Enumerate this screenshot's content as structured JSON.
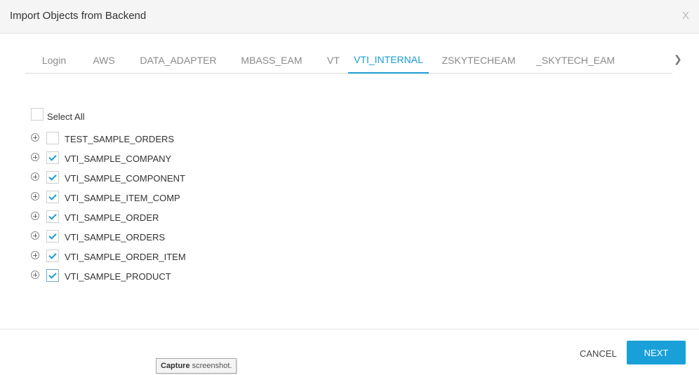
{
  "dialog": {
    "title": "Import Objects from Backend",
    "close_label": "X"
  },
  "tabs": [
    {
      "label": "Login",
      "active": false
    },
    {
      "label": "AWS",
      "active": false
    },
    {
      "label": "DATA_ADAPTER",
      "active": false
    },
    {
      "label": "MBASS_EAM",
      "active": false
    },
    {
      "label": "VT",
      "active": false
    },
    {
      "label": "VTI_INTERNAL",
      "active": true
    },
    {
      "label": "ZSKYTECHEAM",
      "active": false
    },
    {
      "label": "_SKYTECH_EAM",
      "active": false
    }
  ],
  "tab_next_glyph": "❯",
  "select_all": {
    "label": "Select All",
    "checked": false
  },
  "objects": [
    {
      "name": "TEST_SAMPLE_ORDERS",
      "checked": false
    },
    {
      "name": "VTI_SAMPLE_COMPANY",
      "checked": true
    },
    {
      "name": "VTI_SAMPLE_COMPONENT",
      "checked": true
    },
    {
      "name": "VTI_SAMPLE_ITEM_COMP",
      "checked": true
    },
    {
      "name": "VTI_SAMPLE_ORDER",
      "checked": true
    },
    {
      "name": "VTI_SAMPLE_ORDERS",
      "checked": true
    },
    {
      "name": "VTI_SAMPLE_ORDER_ITEM",
      "checked": true
    },
    {
      "name": "VTI_SAMPLE_PRODUCT",
      "checked": true
    }
  ],
  "footer": {
    "cancel_label": "CANCEL",
    "next_label": "NEXT"
  },
  "tooltip": {
    "bold": "Capture",
    "rest": " screenshot."
  },
  "colors": {
    "accent": "#1a9bd0",
    "button": "#1aa0d8"
  }
}
